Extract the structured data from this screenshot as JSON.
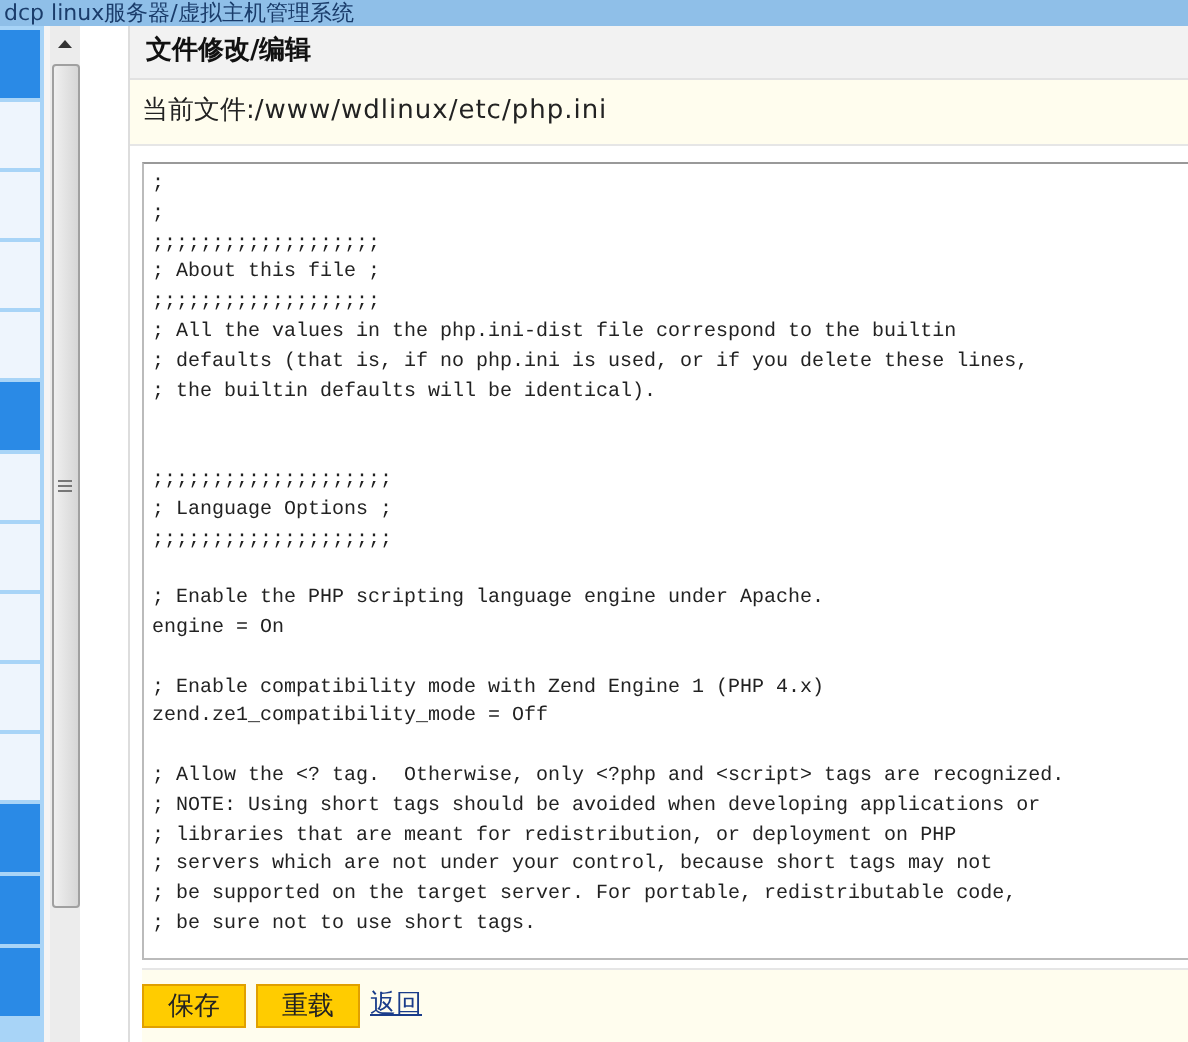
{
  "window": {
    "title": "dcp linux服务器/虚拟主机管理系统"
  },
  "panel": {
    "title": "文件修改/编辑",
    "file_label": "当前文件:",
    "file_path": "/www/wdlinux/etc/php.ini"
  },
  "editor": {
    "blocks": [
      {
        "kind": "header",
        "lines": [
          ";",
          ";",
          ";;;;;;;;;;;;;;;;;;;",
          "; About this file ;",
          ";;;;;;;;;;;;;;;;;;;",
          "; All the values in the php.ini-dist file correspond to the builtin",
          "; defaults (that is, if no php.ini is used, or if you delete these lines,",
          "; the builtin defaults will be identical)."
        ]
      },
      {
        "kind": "section",
        "lines": [
          ";;;;;;;;;;;;;;;;;;;;",
          "; Language Options ;",
          ";;;;;;;;;;;;;;;;;;;;"
        ]
      },
      {
        "kind": "paragraph",
        "lines": [
          "; Enable the PHP scripting language engine under Apache.",
          "engine = On"
        ]
      },
      {
        "kind": "paragraph",
        "lines": [
          "; Enable compatibility mode with Zend Engine 1 (PHP 4.x)",
          "zend.ze1_compatibility_mode = Off"
        ]
      },
      {
        "kind": "paragraph",
        "lines": [
          "; Allow the <? tag.  Otherwise, only <?php and <script> tags are recognized.",
          "; NOTE: Using short tags should be avoided when developing applications or",
          "; libraries that are meant for redistribution, or deployment on PHP",
          "; servers which are not under your control, because short tags may not",
          "; be supported on the target server. For portable, redistributable code,",
          "; be sure not to use short tags."
        ]
      }
    ]
  },
  "actions": [
    {
      "kind": "button",
      "label": "保存"
    },
    {
      "kind": "button",
      "label": "重载"
    },
    {
      "kind": "link",
      "label": "返回"
    }
  ]
}
